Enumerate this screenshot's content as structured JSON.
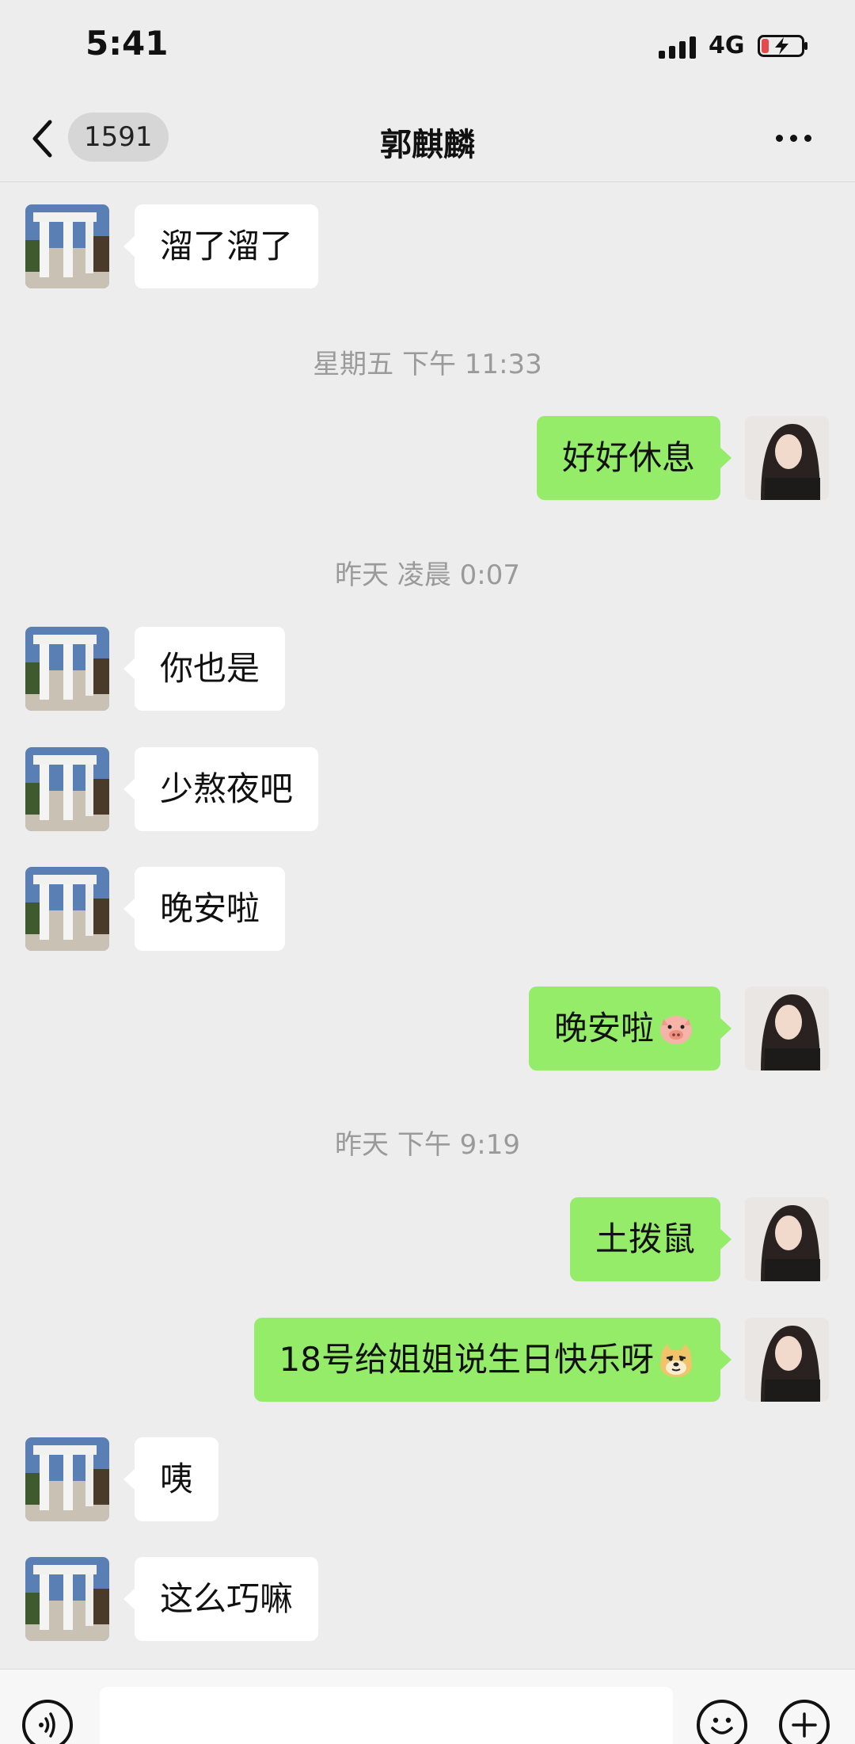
{
  "status_bar": {
    "time": "5:41",
    "network": "4G"
  },
  "nav": {
    "unread_count": "1591",
    "title": "郭麒麟"
  },
  "messages": [
    {
      "side": "in",
      "text": "溜了溜了"
    },
    {
      "type": "time",
      "text": "星期五 下午 11:33"
    },
    {
      "side": "out",
      "text": "好好休息"
    },
    {
      "type": "time",
      "text": "昨天 凌晨 0:07"
    },
    {
      "side": "in",
      "text": "你也是"
    },
    {
      "side": "in",
      "text": "少熬夜吧"
    },
    {
      "side": "in",
      "text": "晚安啦"
    },
    {
      "side": "out",
      "text": "晚安啦",
      "emoji": "pig-face-emoji"
    },
    {
      "type": "time",
      "text": "昨天 下午 9:19"
    },
    {
      "side": "out",
      "text": "土拨鼠"
    },
    {
      "side": "out",
      "text": "18号给姐姐说生日快乐呀",
      "emoji": "doge-emoji"
    },
    {
      "side": "in",
      "text": "咦"
    },
    {
      "side": "in",
      "text": "这么巧嘛"
    }
  ],
  "input": {
    "value": "",
    "icons": [
      "voice-icon",
      "emoji-icon",
      "plus-icon"
    ]
  },
  "colors": {
    "background": "#ededed",
    "incoming_bubble": "#ffffff",
    "outgoing_bubble": "#95ec69",
    "timestamp": "#9a9a9a"
  }
}
